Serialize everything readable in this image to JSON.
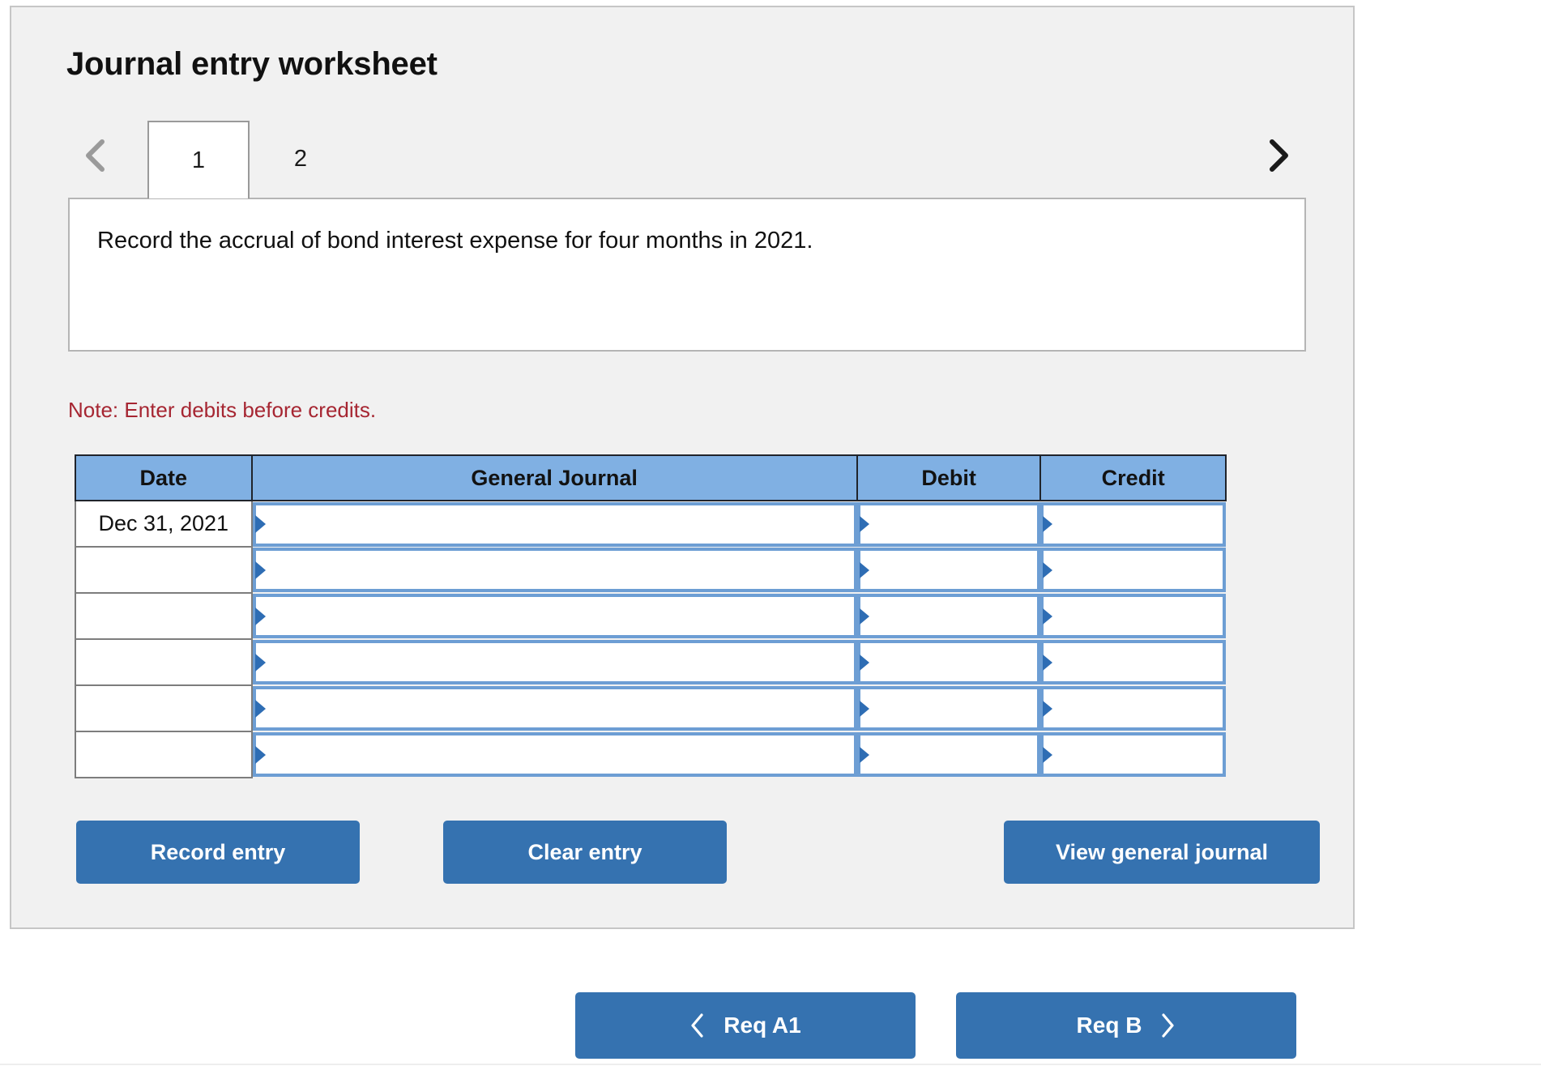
{
  "worksheet": {
    "title": "Journal entry worksheet",
    "tabs": [
      {
        "label": "1",
        "active": true
      },
      {
        "label": "2",
        "active": false
      }
    ],
    "nav": {
      "prev_icon": "chevron-left-icon",
      "next_icon": "chevron-right-icon"
    },
    "instruction": "Record the accrual of bond interest expense for four months in 2021.",
    "note": "Note: Enter debits before credits.",
    "table": {
      "headers": [
        "Date",
        "General Journal",
        "Debit",
        "Credit"
      ],
      "rows": [
        {
          "date": "Dec 31, 2021",
          "journal": "",
          "debit": "",
          "credit": ""
        },
        {
          "date": "",
          "journal": "",
          "debit": "",
          "credit": ""
        },
        {
          "date": "",
          "journal": "",
          "debit": "",
          "credit": ""
        },
        {
          "date": "",
          "journal": "",
          "debit": "",
          "credit": ""
        },
        {
          "date": "",
          "journal": "",
          "debit": "",
          "credit": ""
        },
        {
          "date": "",
          "journal": "",
          "debit": "",
          "credit": ""
        }
      ]
    },
    "actions": {
      "record_entry": "Record entry",
      "clear_entry": "Clear entry",
      "view_general_journal": "View general journal"
    }
  },
  "requirement_nav": {
    "prev": {
      "label": "Req A1",
      "icon": "chevron-left-icon"
    },
    "next": {
      "label": "Req B",
      "icon": "chevron-right-icon"
    }
  },
  "colors": {
    "accent_blue": "#3572b0",
    "header_blue": "#80b0e3",
    "input_border_blue": "#6d9ed4",
    "marker_blue": "#2e6db4",
    "note_red": "#a62632",
    "panel_bg": "#f1f1f1"
  }
}
